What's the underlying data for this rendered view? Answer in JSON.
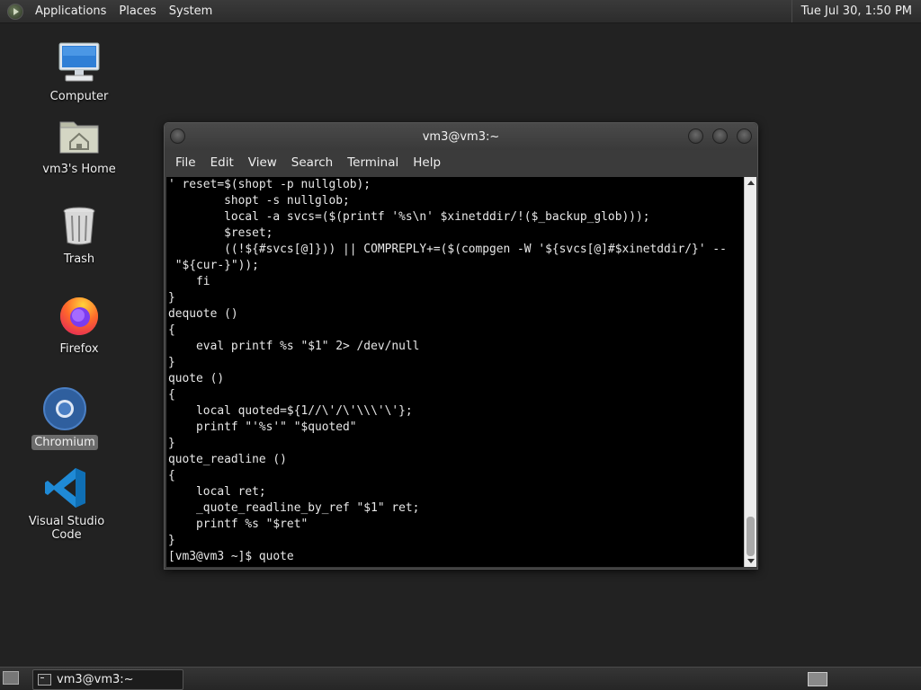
{
  "top_panel": {
    "menus": [
      "Applications",
      "Places",
      "System"
    ],
    "clock": "Tue Jul 30,  1:50 PM"
  },
  "desktop": {
    "icons": [
      {
        "label": "Computer",
        "icon": "computer-icon"
      },
      {
        "label": "vm3's Home",
        "icon": "home-folder-icon"
      },
      {
        "label": "Trash",
        "icon": "trash-icon"
      },
      {
        "label": "Firefox",
        "icon": "firefox-icon"
      },
      {
        "label": "Chromium",
        "icon": "chromium-icon",
        "selected": true
      },
      {
        "label": "Visual Studio Code",
        "icon": "vscode-icon"
      }
    ]
  },
  "terminal_window": {
    "title": "vm3@vm3:~",
    "menus": [
      "File",
      "Edit",
      "View",
      "Search",
      "Terminal",
      "Help"
    ],
    "lines": [
      "' reset=$(shopt -p nullglob);",
      "        shopt -s nullglob;",
      "        local -a svcs=($(printf '%s\\n' $xinetddir/!($_backup_glob)));",
      "        $reset;",
      "        ((!${#svcs[@]})) || COMPREPLY+=($(compgen -W '${svcs[@]#$xinetddir/}' --",
      " \"${cur-}\"));",
      "    fi",
      "}",
      "dequote ()",
      "{",
      "    eval printf %s \"$1\" 2> /dev/null",
      "}",
      "quote ()",
      "{",
      "    local quoted=${1//\\'/\\'\\\\\\'\\'};",
      "    printf \"'%s'\" \"$quoted\"",
      "}",
      "quote_readline ()",
      "{",
      "    local ret;",
      "    _quote_readline_by_ref \"$1\" ret;",
      "    printf %s \"$ret\"",
      "}",
      "[vm3@vm3 ~]$ quote"
    ]
  },
  "bottom_panel": {
    "task_label": "vm3@vm3:~"
  }
}
